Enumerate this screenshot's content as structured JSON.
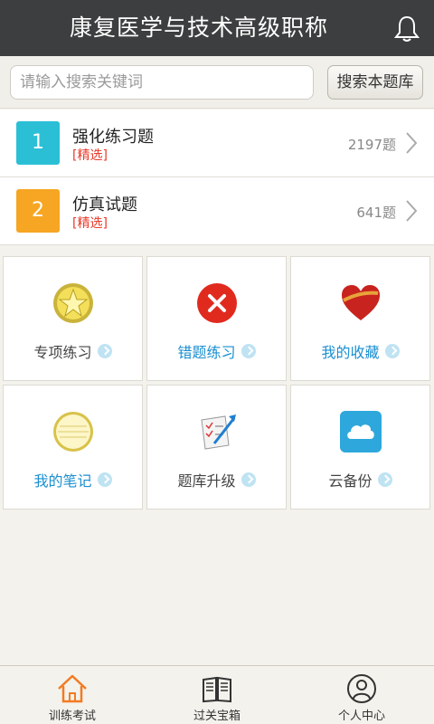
{
  "header": {
    "title": "康复医学与技术高级职称",
    "bell_icon": "bell-icon"
  },
  "search": {
    "placeholder": "请输入搜索关键词",
    "button_label": "搜索本题库"
  },
  "list": [
    {
      "num": "1",
      "title": "强化练习题",
      "tag": "[精选]",
      "count": "2197题",
      "color": "#2bbfd6"
    },
    {
      "num": "2",
      "title": "仿真试题",
      "tag": "[精选]",
      "count": "641题",
      "color": "#f6a623"
    }
  ],
  "grid": [
    {
      "label": "专项练习",
      "icon": "star-badge-icon",
      "color": "#444444"
    },
    {
      "label": "错题练习",
      "icon": "wrong-cross-icon",
      "color": "#1a8fd0"
    },
    {
      "label": "我的收藏",
      "icon": "heart-icon",
      "color": "#1a8fd0"
    },
    {
      "label": "我的笔记",
      "icon": "notepad-icon",
      "color": "#1a8fd0"
    },
    {
      "label": "题库升级",
      "icon": "upgrade-document-icon",
      "color": "#444444"
    },
    {
      "label": "云备份",
      "icon": "cloud-icon",
      "color": "#444444"
    }
  ],
  "tabs": [
    {
      "label": "训练考试",
      "icon": "home-icon",
      "active": true
    },
    {
      "label": "过关宝箱",
      "icon": "book-icon",
      "active": false
    },
    {
      "label": "个人中心",
      "icon": "user-icon",
      "active": false
    }
  ]
}
